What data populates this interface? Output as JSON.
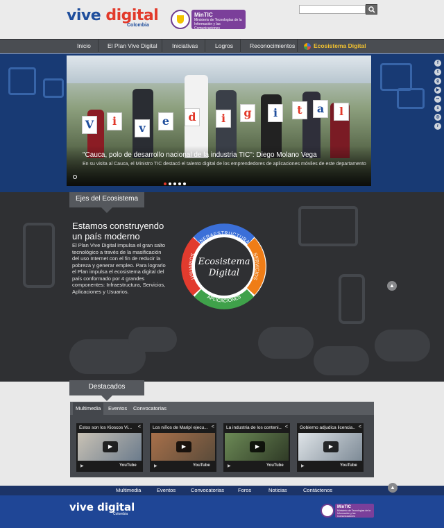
{
  "header": {
    "logo_vive": "vive",
    "logo_digital": "digital",
    "logo_country": "Colombia",
    "ministry_badge": "MinTIC",
    "ministry_name": "Ministerio de Tecnologías de la Información y las Comunicaciones",
    "search_placeholder": ""
  },
  "nav": {
    "items": [
      "Inicio",
      "El Plan Vive Digital",
      "Iniciativas",
      "Logros",
      "Reconocimientos",
      "Ecosistema Digital"
    ]
  },
  "hero": {
    "slide_title": "\"Cauca, polo de desarrollo nacional de la industria TIC\": Diego Molano Vega",
    "slide_text": "En su visita al Cauca, el Ministro TIC destacó el talento digital de los emprendedores de aplicaciones móviles de este departamento",
    "cards": [
      "V",
      "i",
      "v",
      "e",
      "d",
      "i",
      "g",
      "i",
      "t",
      "a",
      "l"
    ],
    "slide_count": 5,
    "active_slide": 1,
    "social_icons": [
      "facebook-icon",
      "twitter-icon",
      "google-plus-icon",
      "youtube-icon",
      "flickr-icon",
      "slideshare-icon",
      "instagram-icon",
      "rss-icon"
    ]
  },
  "eco": {
    "tab_label": "Ejes del Ecosistema",
    "heading": "Estamos construyendo un país moderno",
    "body": "El Plan Vive Digital impulsa el gran salto tecnológico a través de la masificación del uso Internet con el fin de reducir la pobreza y generar empleo. Para lograrlo el Plan impulsa el ecosistema digital del país conformado por 4 grandes componentes: Infraestructura, Servicios, Aplicaciones y Usuarios.",
    "ring_center_1": "Ecosistema",
    "ring_center_2": "Digital",
    "segments": [
      "INFRAESTRUCTURA",
      "SERVICIOS",
      "APLICACIONES",
      "USUARIOS"
    ],
    "colors": {
      "infra": "#3b6fd8",
      "servicios": "#ef7d17",
      "aplicaciones": "#3fa14a",
      "usuarios": "#e23b2e"
    }
  },
  "destacados": {
    "tab_label": "Destacados",
    "tabs": [
      "Multimedia",
      "Eventos",
      "Convocatorias"
    ],
    "videos": [
      {
        "title": "Estos son los Kioscos Vi..."
      },
      {
        "title": "Los niños de Maripí ejecu..."
      },
      {
        "title": "La industria de los conteni..."
      },
      {
        "title": "Gobierno adjudica licencia..."
      }
    ],
    "youtube_label": "YouTube"
  },
  "footer": {
    "nav": [
      "Multimedia",
      "Eventos",
      "Convocatorias",
      "Foros",
      "Noticias",
      "Contáctenos"
    ],
    "logo": "vive digital",
    "logo_country": "Colombia",
    "ministry_badge": "MinTIC",
    "ministry_name": "Ministerio de Tecnologías de la Información y las Comunicaciones"
  }
}
